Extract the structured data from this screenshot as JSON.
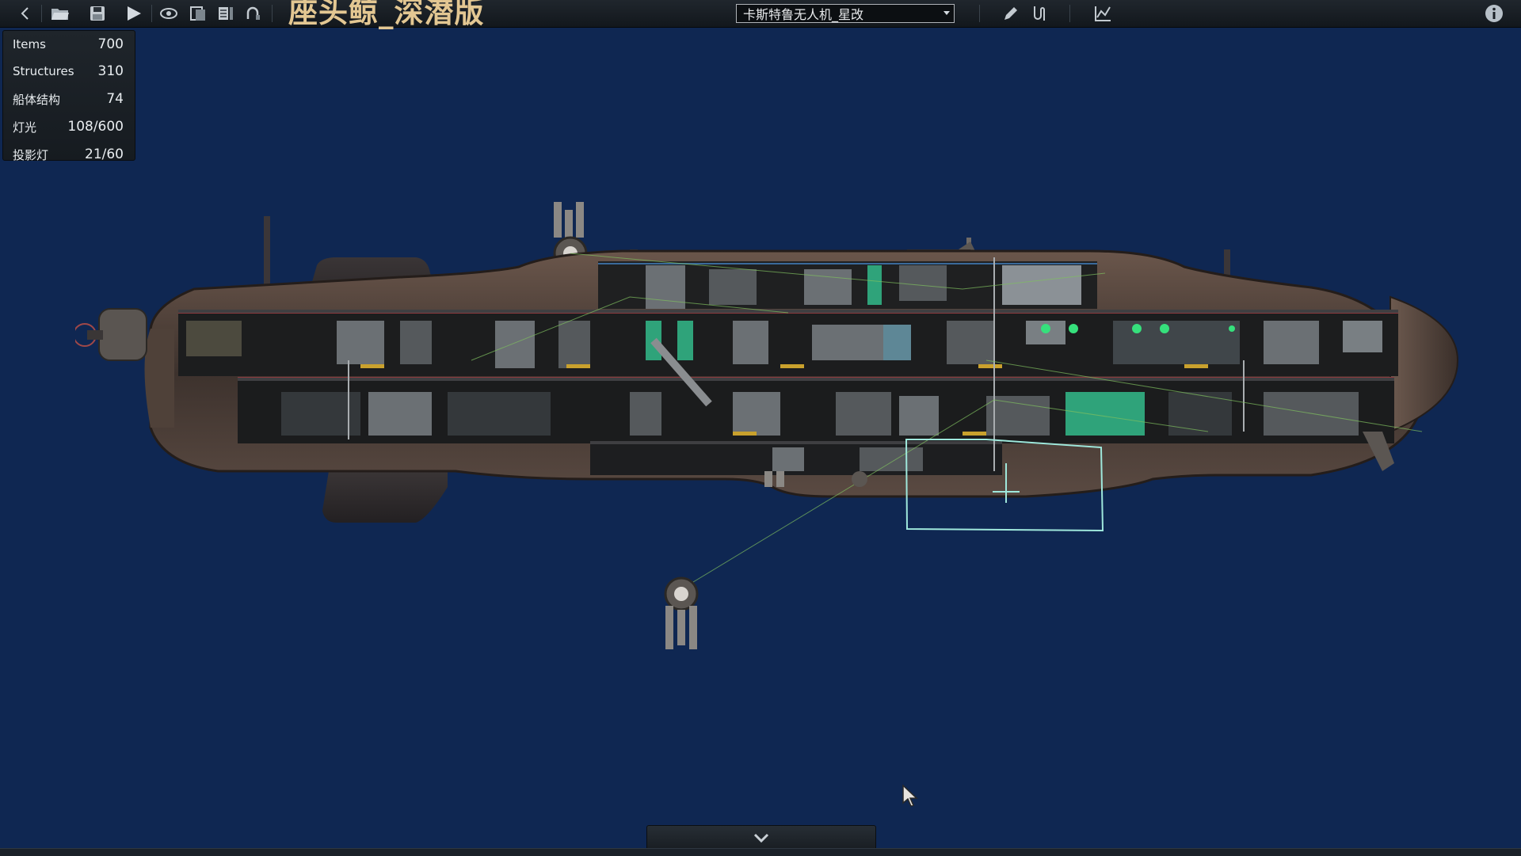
{
  "app": {
    "submarine_name": "座头鲸_深潜版",
    "preset_select": {
      "value": "卡斯特鲁无人机_星改"
    }
  },
  "toolbar": {
    "icons": [
      "back-icon",
      "open-folder-icon",
      "save-icon",
      "play-icon",
      "visibility-icon",
      "layers-icon",
      "layers-alt-icon",
      "undo-icon",
      "pencil-icon",
      "wiring-icon",
      "waypoint-icon",
      "info-icon"
    ]
  },
  "stats": [
    {
      "label": "Items",
      "value": "700"
    },
    {
      "label": "Structures",
      "value": "310"
    },
    {
      "label": "船体结构",
      "value": "74"
    },
    {
      "label": "灯光",
      "value": "108/600"
    },
    {
      "label": "投影灯",
      "value": "21/60"
    }
  ],
  "colors": {
    "background": "#0f2752",
    "title": "#e3c792",
    "toolbar": "#1a1f25",
    "hull": "#4c3f38",
    "selection": "#9fe8dc"
  }
}
